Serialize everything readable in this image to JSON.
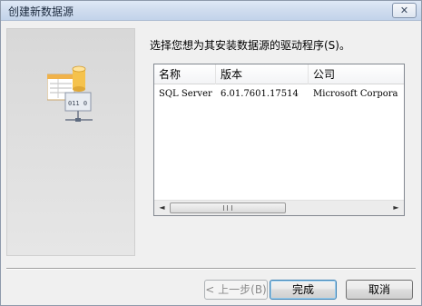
{
  "window": {
    "title": "创建新数据源",
    "close_symbol": "✕"
  },
  "prompt": "选择您想为其安装数据源的驱动程序(S)。",
  "driver_list": {
    "columns": [
      "名称",
      "版本",
      "公司"
    ],
    "rows": [
      {
        "name": "SQL Server",
        "version": "6.01.7601.17514",
        "company": "Microsoft Corpora"
      }
    ]
  },
  "illustration": {
    "binary_text": "011 0"
  },
  "buttons": {
    "back": "< 上一步(B)",
    "finish": "完成",
    "cancel": "取消"
  },
  "scrollbar": {
    "left_arrow": "◄",
    "right_arrow": "►"
  }
}
